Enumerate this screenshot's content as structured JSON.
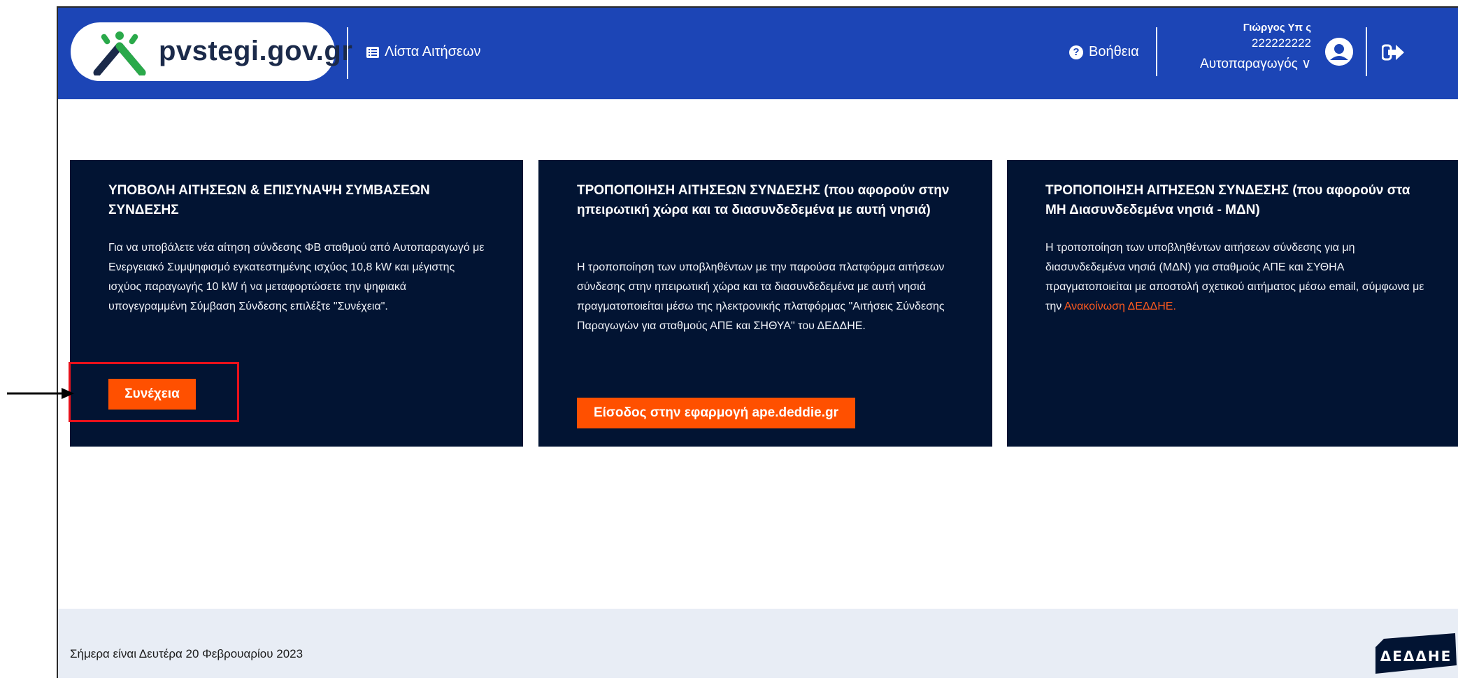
{
  "header": {
    "logo_text": "pvstegi.gov.gr",
    "nav_applications": "Λίστα Αιτήσεων",
    "help": "Βοήθεια",
    "user_name": "Γιώργος Υπ        ς",
    "user_afm": "222222222",
    "user_role": "Αυτοπαραγωγός ∨"
  },
  "cards": [
    {
      "title": "ΥΠΟΒΟΛΗ ΑΙΤΗΣΕΩΝ & ΕΠΙΣΥΝΑΨΗ ΣΥΜΒΑΣΕΩΝ ΣΥΝΔΕΣΗΣ",
      "body": "Για να υποβάλετε νέα αίτηση σύνδεσης ΦΒ σταθμού από Αυτοπαραγωγό με Ενεργειακό Συμψηφισμό εγκατεστημένης ισχύος 10,8 kW και μέγιστης ισχύος παραγωγής 10 kW ή να μεταφορτώσετε την ψηφιακά υπογεγραμμένη Σύμβαση Σύνδεσης επιλέξτε \"Συνέχεια\".",
      "button": "Συνέχεια"
    },
    {
      "title": "ΤΡΟΠΟΠΟΙΗΣΗ ΑΙΤΗΣΕΩΝ ΣΥΝΔΕΣΗΣ (που αφορούν στην ηπειρωτική χώρα και τα διασυνδεδεμένα με αυτή νησιά)",
      "body": "Η τροποποίηση των υποβληθέντων με την παρούσα πλατφόρμα αιτήσεων σύνδεσης στην ηπειρωτική χώρα και τα διασυνδεδεμένα με αυτή νησιά πραγματοποιείται μέσω της ηλεκτρονικής πλατφόρμας \"Αιτήσεις Σύνδεσης Παραγωγών για σταθμούς ΑΠΕ και ΣΗΘΥΑ\" του ΔΕΔΔΗΕ.",
      "button": "Είσοδος στην εφαρμογή ape.deddie.gr"
    },
    {
      "title": "ΤΡΟΠΟΠΟΙΗΣΗ ΑΙΤΗΣΕΩΝ ΣΥΝΔΕΣΗΣ (που αφορούν στα ΜΗ Διασυνδεδεμένα νησιά - ΜΔΝ)",
      "body": "Η τροποποίηση των υποβληθέντων αιτήσεων σύνδεσης για μη διασυνδεδεμένα νησιά (ΜΔΝ) για σταθμούς ΑΠΕ και ΣΥΘΗΑ πραγματοποιείται με αποστολή σχετικού αιτήματος μέσω email, σύμφωνα με την",
      "link": "Ανακοίνωση ΔΕΔΔΗΕ."
    }
  ],
  "footer": {
    "date_text": "Σήμερα είναι Δευτέρα 20 Φεβρουαρίου 2023",
    "logo_text": "ΔΕΔΔΗΕ"
  },
  "colors": {
    "header_bg": "#1c45b6",
    "card_bg": "#021433",
    "accent": "#ff5000",
    "highlight": "#e8111b",
    "footer_bg": "#e8edf5"
  },
  "icons": [
    "list-icon",
    "help-icon",
    "user-avatar-icon",
    "logout-icon",
    "arrow-right-icon"
  ]
}
